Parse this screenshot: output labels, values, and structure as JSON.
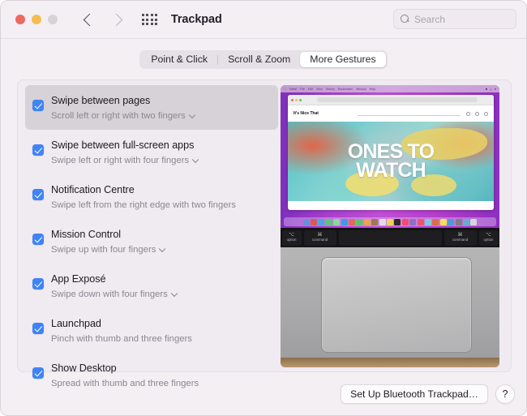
{
  "window": {
    "title": "Trackpad",
    "traffic_lights": [
      "close",
      "minimize",
      "zoom"
    ],
    "nav": {
      "back": "back-chevron",
      "forward": "forward-chevron"
    },
    "grid_icon": "all-preferences-grid-icon"
  },
  "search": {
    "placeholder": "Search",
    "value": "",
    "icon": "search-icon"
  },
  "tabs": [
    {
      "label": "Point & Click",
      "active": false
    },
    {
      "label": "Scroll & Zoom",
      "active": false
    },
    {
      "label": "More Gestures",
      "active": true
    }
  ],
  "gestures": [
    {
      "title": "Swipe between pages",
      "description": "Scroll left or right with two fingers",
      "checked": true,
      "has_options": true,
      "selected": true
    },
    {
      "title": "Swipe between full-screen apps",
      "description": "Swipe left or right with four fingers",
      "checked": true,
      "has_options": true,
      "selected": false
    },
    {
      "title": "Notification Centre",
      "description": "Swipe left from the right edge with two fingers",
      "checked": true,
      "has_options": false,
      "selected": false
    },
    {
      "title": "Mission Control",
      "description": "Swipe up with four fingers",
      "checked": true,
      "has_options": true,
      "selected": false
    },
    {
      "title": "App Exposé",
      "description": "Swipe down with four fingers",
      "checked": true,
      "has_options": true,
      "selected": false
    },
    {
      "title": "Launchpad",
      "description": "Pinch with thumb and three fingers",
      "checked": true,
      "has_options": false,
      "selected": false
    },
    {
      "title": "Show Desktop",
      "description": "Spread with thumb and three fingers",
      "checked": true,
      "has_options": false,
      "selected": false
    }
  ],
  "preview": {
    "name": "gesture-demo-video",
    "site_brand": "It's Nice That",
    "hero_line1": "ONES TO",
    "hero_line2": "WATCH",
    "menubar_items": [
      "Safari",
      "File",
      "Edit",
      "View",
      "History",
      "Bookmarks",
      "Window",
      "Help"
    ],
    "keys": [
      {
        "sym": "⌥",
        "label": "option"
      },
      {
        "sym": "⌘",
        "label": "command"
      },
      {
        "sym": "",
        "label": ""
      },
      {
        "sym": "⌘",
        "label": "command"
      },
      {
        "sym": "⌥",
        "label": "option"
      }
    ]
  },
  "footer": {
    "setup_button": "Set Up Bluetooth Trackpad…",
    "help_button": "?"
  },
  "colors": {
    "accent": "#3f84f6",
    "window_bg": "#f3eff2",
    "panel_bg": "#f0eaf1",
    "selected_row": "#d7d2d8",
    "title_text": "#1d1a22",
    "subtitle_text": "#8b8691"
  }
}
